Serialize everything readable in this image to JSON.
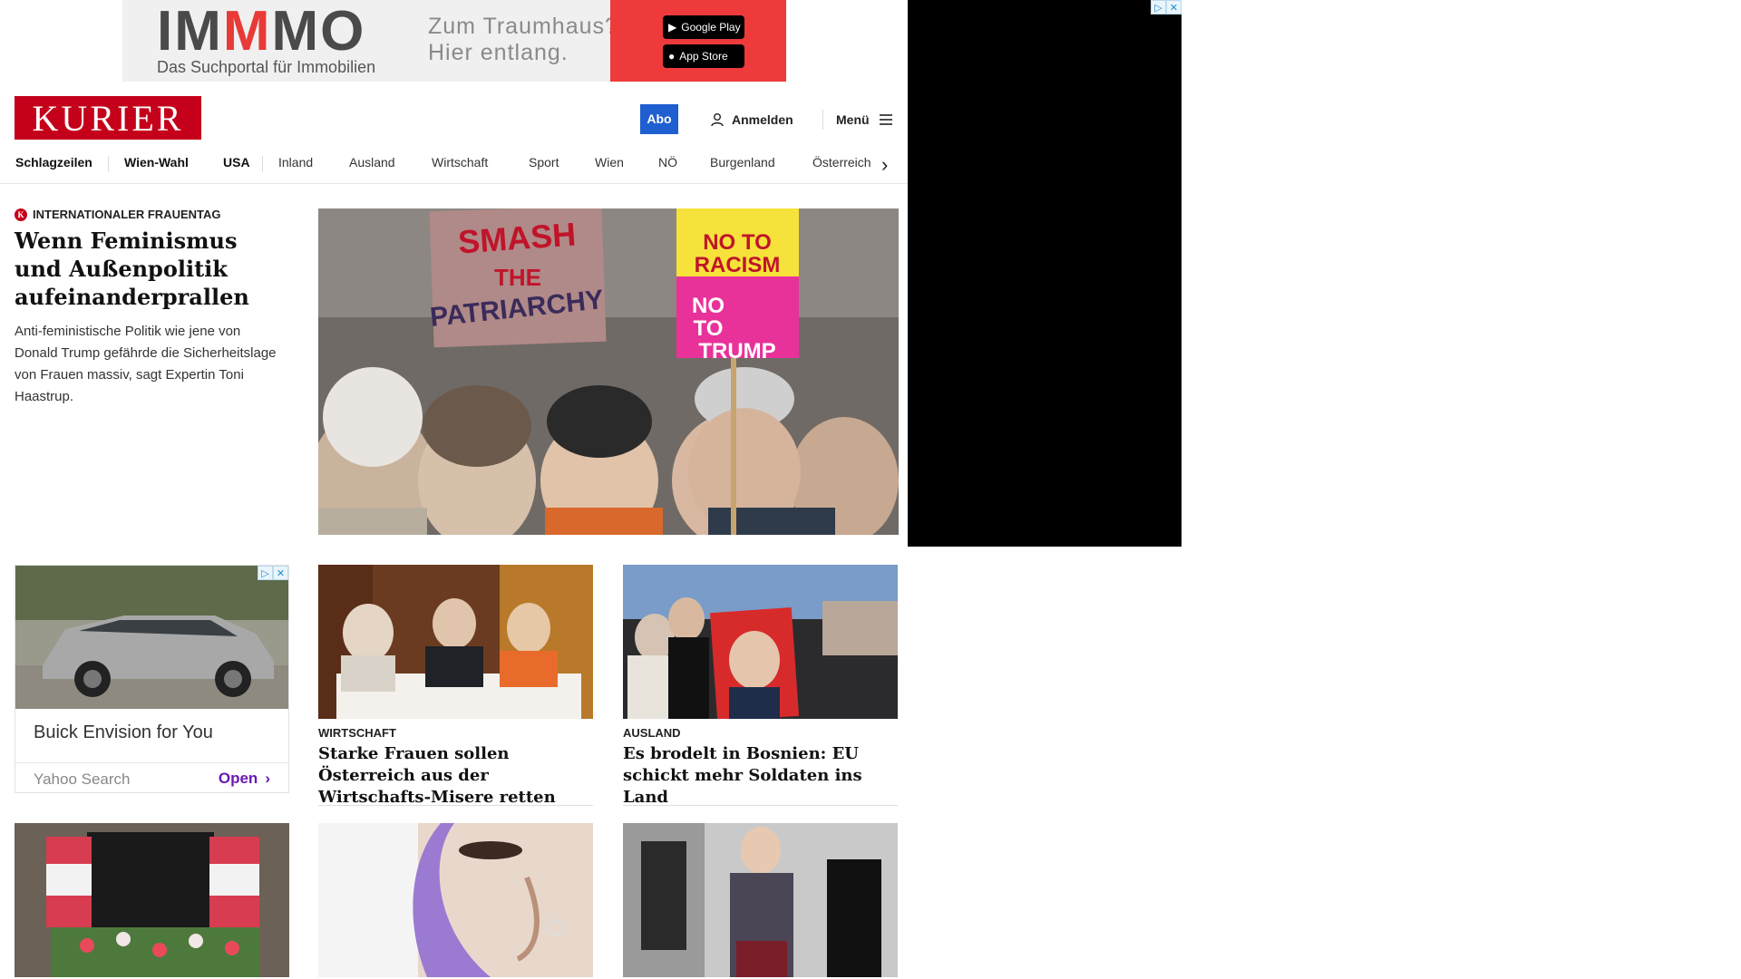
{
  "top_ad": {
    "brand_pre": "IM",
    "brand_mid": "M",
    "brand_post": "MO",
    "tagline": "Das Suchportal für Immobilien",
    "headline_1": "Zum Traumhaus?",
    "headline_2": "Hier entlang.",
    "google_play": "Google Play",
    "app_store": "App Store"
  },
  "header": {
    "logo": "KURIER",
    "abo": "Abo",
    "login": "Anmelden",
    "menu": "Menü"
  },
  "nav": [
    "Schlagzeilen",
    "Wien-Wahl",
    "USA",
    "Inland",
    "Ausland",
    "Wirtschaft",
    "Sport",
    "Wien",
    "NÖ",
    "Burgenland",
    "Österreich"
  ],
  "hero": {
    "kicker": "INTERNATIONALER FRAUENTAG",
    "title": "Wenn Feminismus und Außenpolitik aufeinanderprallen",
    "teaser": "Anti-feministische Politik wie jene von Donald Trump gefährde die Sicherheitslage von Frauen massiv, sagt Expertin Toni Haastrup.",
    "sign_1": "SMASH THE PATRIARCHY",
    "sign_2": "NO TO RACISM",
    "sign_3": "NO TO TRUMP"
  },
  "grid_ad": {
    "title": "Buick Envision for You",
    "source": "Yahoo Search",
    "cta": "Open"
  },
  "cards": [
    {
      "kicker": "WIRTSCHAFT",
      "title": "Starke Frauen sollen Österreich aus der Wirtschafts-Misere retten"
    },
    {
      "kicker": "AUSLAND",
      "title": "Es brodelt in Bosnien: EU schickt mehr Soldaten ins Land"
    }
  ],
  "colors": {
    "brand_red": "#c4001a",
    "abo_blue": "#1f5fcf",
    "ad_cta_purple": "#6a1ab3"
  }
}
